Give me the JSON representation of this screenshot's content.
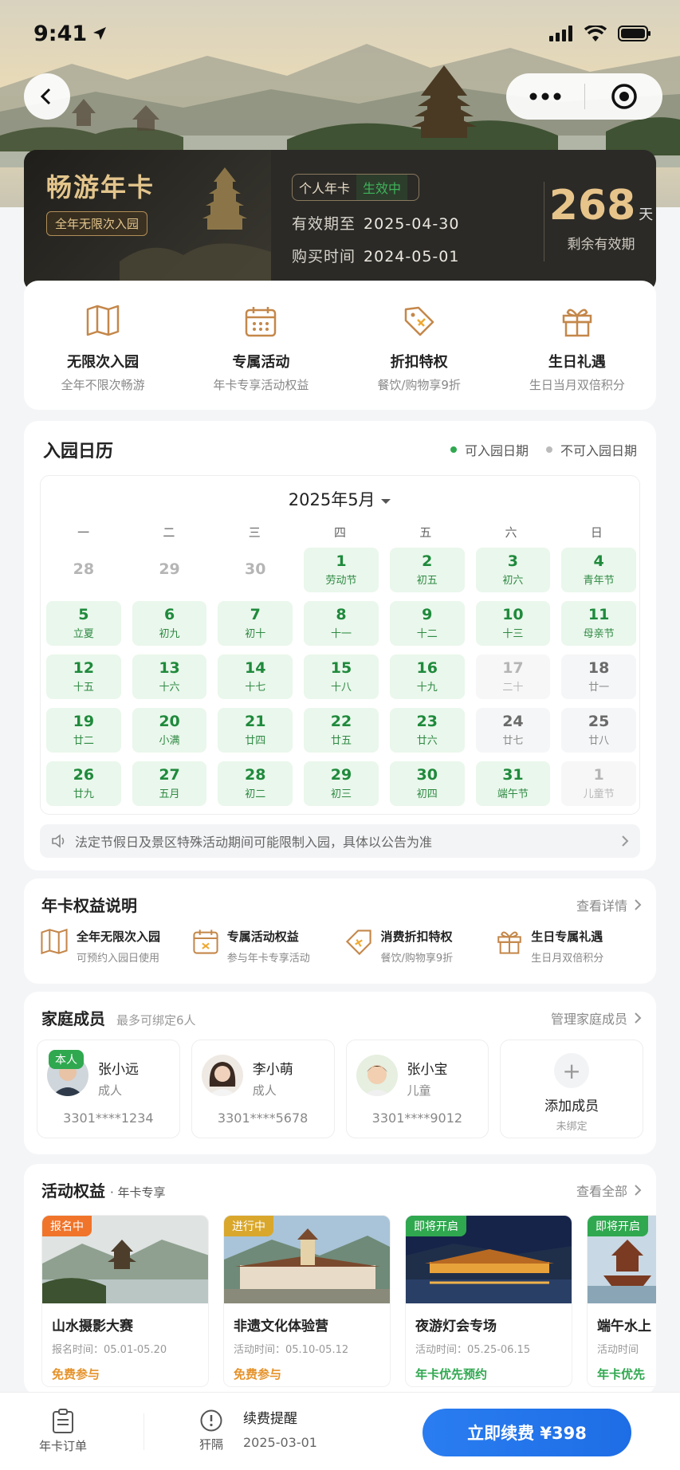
{
  "status_bar": {
    "time": "9:41"
  },
  "header": {
    "back_icon": "chevron-left-icon",
    "more_icon": "more-dots-icon",
    "close_icon": "target-close-icon"
  },
  "pass": {
    "title": "畅游年卡",
    "tag": "全年无限次入园",
    "type_label": "个人年卡",
    "status_label": "生效中",
    "valid_until_label": "有效期至",
    "valid_until": "2025-04-30",
    "purchase_label": "购买时间",
    "purchase_date": "2024-05-01",
    "days_left": "268",
    "days_unit": "天",
    "days_label": "剩余有效期"
  },
  "benefits": [
    {
      "icon": "map-icon",
      "title": "无限次入园",
      "sub": "全年不限次畅游"
    },
    {
      "icon": "calendar-icon",
      "title": "专属活动",
      "sub": "年卡专享活动权益"
    },
    {
      "icon": "discount-tag-icon",
      "title": "折扣特权",
      "sub": "餐饮/购物享9折"
    },
    {
      "icon": "gift-icon",
      "title": "生日礼遇",
      "sub": "生日当月双倍积分"
    }
  ],
  "calendar": {
    "title": "入园日历",
    "legend_ok": "可入园日期",
    "legend_no": "不可入园日期",
    "month": "2025年5月",
    "weekdays": [
      "一",
      "二",
      "三",
      "四",
      "五",
      "六",
      "日"
    ],
    "colors": {
      "ok": "#2fa84f",
      "no": "#bbbbbb"
    },
    "cells": [
      {
        "d": "28",
        "l": "",
        "s": "prev"
      },
      {
        "d": "29",
        "l": "",
        "s": "prev"
      },
      {
        "d": "30",
        "l": "",
        "s": "prev"
      },
      {
        "d": "1",
        "l": "劳动节",
        "s": "ok"
      },
      {
        "d": "2",
        "l": "初五",
        "s": "ok"
      },
      {
        "d": "3",
        "l": "初六",
        "s": "ok"
      },
      {
        "d": "4",
        "l": "青年节",
        "s": "ok"
      },
      {
        "d": "5",
        "l": "立夏",
        "s": "ok"
      },
      {
        "d": "6",
        "l": "初九",
        "s": "ok"
      },
      {
        "d": "7",
        "l": "初十",
        "s": "ok"
      },
      {
        "d": "8",
        "l": "十一",
        "s": "ok"
      },
      {
        "d": "9",
        "l": "十二",
        "s": "ok"
      },
      {
        "d": "10",
        "l": "十三",
        "s": "ok"
      },
      {
        "d": "11",
        "l": "母亲节",
        "s": "ok"
      },
      {
        "d": "12",
        "l": "十五",
        "s": "ok"
      },
      {
        "d": "13",
        "l": "十六",
        "s": "ok"
      },
      {
        "d": "14",
        "l": "十七",
        "s": "ok"
      },
      {
        "d": "15",
        "l": "十八",
        "s": "ok"
      },
      {
        "d": "16",
        "l": "十九",
        "s": "ok"
      },
      {
        "d": "17",
        "l": "二十",
        "s": "fade"
      },
      {
        "d": "18",
        "l": "廿一",
        "s": "no"
      },
      {
        "d": "19",
        "l": "廿二",
        "s": "ok"
      },
      {
        "d": "20",
        "l": "小满",
        "s": "ok"
      },
      {
        "d": "21",
        "l": "廿四",
        "s": "ok"
      },
      {
        "d": "22",
        "l": "廿五",
        "s": "ok"
      },
      {
        "d": "23",
        "l": "廿六",
        "s": "ok"
      },
      {
        "d": "24",
        "l": "廿七",
        "s": "no"
      },
      {
        "d": "25",
        "l": "廿八",
        "s": "no"
      },
      {
        "d": "26",
        "l": "廿九",
        "s": "ok"
      },
      {
        "d": "27",
        "l": "五月",
        "s": "ok"
      },
      {
        "d": "28",
        "l": "初二",
        "s": "ok"
      },
      {
        "d": "29",
        "l": "初三",
        "s": "ok"
      },
      {
        "d": "30",
        "l": "初四",
        "s": "ok"
      },
      {
        "d": "31",
        "l": "端午节",
        "s": "ok"
      },
      {
        "d": "1",
        "l": "儿童节",
        "s": "fade"
      }
    ],
    "notice": "法定节假日及景区特殊活动期间可能限制入园，具体以公告为准"
  },
  "rights": {
    "title": "年卡权益说明",
    "link": "查看详情",
    "items": [
      {
        "icon": "map-icon",
        "title": "全年无限次入园",
        "sub": "可预约入园日使用"
      },
      {
        "icon": "calendar-icon",
        "title": "专属活动权益",
        "sub": "参与年卡专享活动"
      },
      {
        "icon": "discount-tag-icon",
        "title": "消费折扣特权",
        "sub": "餐饮/购物享9折"
      },
      {
        "icon": "gift-icon",
        "title": "生日专属礼遇",
        "sub": "生日月双倍积分"
      }
    ]
  },
  "family": {
    "title": "家庭成员",
    "hint": "最多可绑定6人",
    "link": "管理家庭成员",
    "self_tag": "本人",
    "members": [
      {
        "name": "张小远",
        "role": "成人",
        "id": "3301****1234"
      },
      {
        "name": "李小萌",
        "role": "成人",
        "id": "3301****5678"
      },
      {
        "name": "张小宝",
        "role": "儿童",
        "id": "3301****9012"
      }
    ],
    "add": {
      "title": "添加成员",
      "sub": "未绑定"
    }
  },
  "activities": {
    "title": "活动权益",
    "subtitle": "· 年卡专享",
    "link": "查看全部",
    "items": [
      {
        "badge": "报名中",
        "badge_color": "#f0742a",
        "title": "山水摄影大赛",
        "sub": "报名时间：05.01-05.20",
        "price": "免费参与",
        "price_color": "#e5922a"
      },
      {
        "badge": "进行中",
        "badge_color": "#d9a72c",
        "title": "非遗文化体验营",
        "sub": "活动时间：05.10-05.12",
        "price": "免费参与",
        "price_color": "#e5922a"
      },
      {
        "badge": "即将开启",
        "badge_color": "#2fa84f",
        "title": "夜游灯会专场",
        "sub": "活动时间：05.25-06.15",
        "price": "年卡优先预约",
        "price_color": "#2fa84f"
      },
      {
        "badge": "即将开启",
        "badge_color": "#2fa84f",
        "title": "端午水上",
        "sub": "活动时间",
        "price": "年卡优先",
        "price_color": "#2fa84f"
      }
    ]
  },
  "bottom_bar": {
    "orders_label": "年卡订单",
    "reminder_tab_label": "犴隔",
    "remind_title": "续费提醒",
    "remind_date": "2025-03-01",
    "renew_label": "立即续费 ¥398"
  }
}
